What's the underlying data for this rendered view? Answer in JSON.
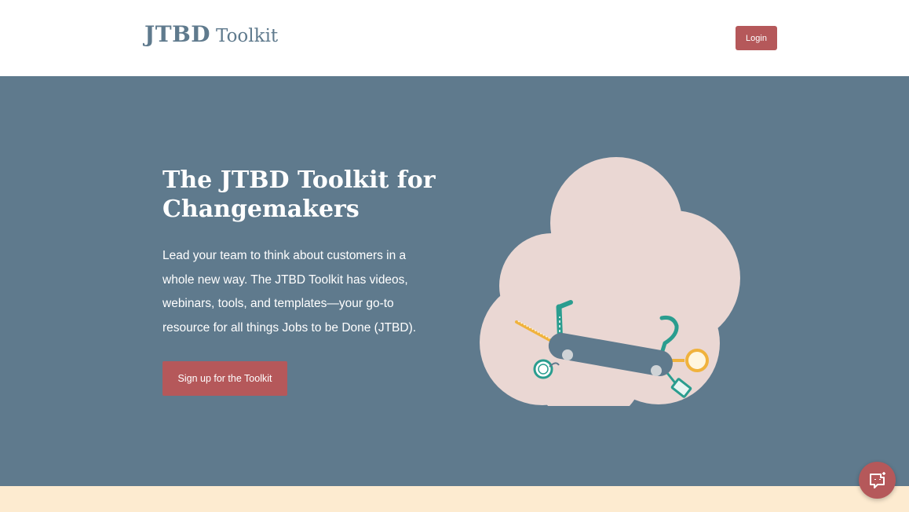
{
  "colors": {
    "brand_slate": "#5f7a8d",
    "accent_red": "#b5585a",
    "cloud_pink": "#ead7d3",
    "teal": "#2a9d8f",
    "gold": "#f0b23c",
    "cream": "#fdebd0"
  },
  "header": {
    "logo_strong": "JTBD",
    "logo_light": "Toolkit",
    "login_label": "Login"
  },
  "hero": {
    "title": "The JTBD Toolkit for Changemakers",
    "description": "Lead your team to think about customers in a whole new way. The JTBD Toolkit has videos, webinars, tools, and templates—your go-to resource for all things Jobs to be Done (JTBD).",
    "cta_label": "Sign up for the Toolkit",
    "illustration": "swiss-army-knife-on-cloud"
  },
  "chat": {
    "icon": "chat-bubble-icon"
  }
}
